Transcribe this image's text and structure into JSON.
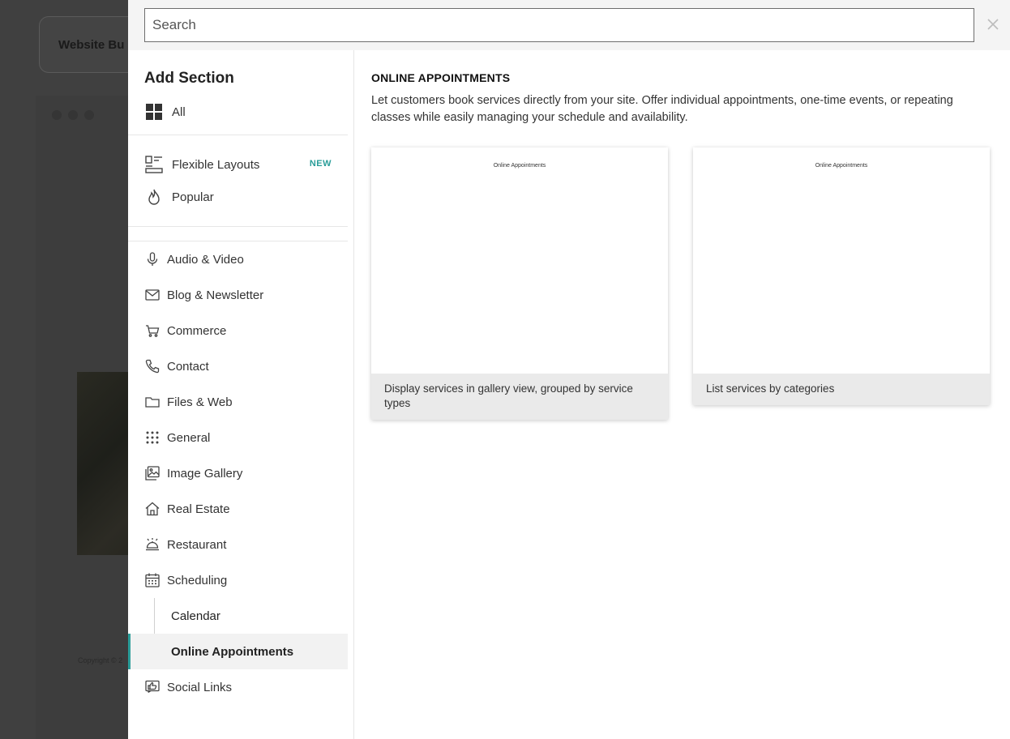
{
  "background": {
    "header_title": "Website Bu",
    "copyright": "Copyright © 2"
  },
  "search": {
    "placeholder": "Search"
  },
  "sidebar": {
    "title": "Add Section",
    "top_items": [
      {
        "label": "All",
        "icon": "grid-icon"
      },
      {
        "label": "Flexible Layouts",
        "icon": "layouts-icon",
        "badge": "NEW"
      },
      {
        "label": "Popular",
        "icon": "flame-icon"
      }
    ],
    "categories": [
      {
        "label": "Audio & Video",
        "icon": "microphone-icon"
      },
      {
        "label": "Blog & Newsletter",
        "icon": "envelope-icon"
      },
      {
        "label": "Commerce",
        "icon": "cart-icon"
      },
      {
        "label": "Contact",
        "icon": "phone-icon"
      },
      {
        "label": "Files & Web",
        "icon": "folder-icon"
      },
      {
        "label": "General",
        "icon": "dots-grid-icon"
      },
      {
        "label": "Image Gallery",
        "icon": "gallery-icon"
      },
      {
        "label": "Real Estate",
        "icon": "house-icon"
      },
      {
        "label": "Restaurant",
        "icon": "cloche-icon"
      },
      {
        "label": "Scheduling",
        "icon": "calendar-icon"
      }
    ],
    "scheduling_sub": [
      {
        "label": "Calendar",
        "active": false
      },
      {
        "label": "Online Appointments",
        "active": true
      }
    ],
    "last_category": {
      "label": "Social Links",
      "icon": "thumbs-up-icon"
    }
  },
  "main": {
    "title": "ONLINE APPOINTMENTS",
    "description": "Let customers book services directly from your site. Offer individual appointments, one-time events, or repeating classes while easily managing your schedule and availability.",
    "cards": [
      {
        "preview_title": "Online Appointments",
        "caption": "Display services in gallery view, grouped by service types"
      },
      {
        "preview_title": "Online Appointments",
        "caption": "List services by categories"
      }
    ]
  },
  "colors": {
    "accent": "#2a9d99",
    "overlay": "#404040"
  }
}
